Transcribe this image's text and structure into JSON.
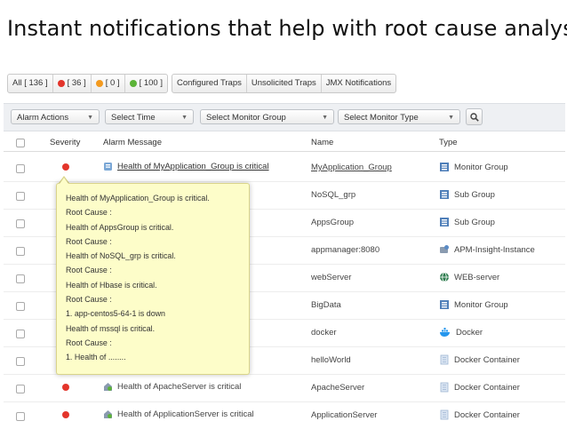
{
  "headline": "Instant notifications that help with root cause analysis",
  "filter_tabs": {
    "all": "All [ 136 ]",
    "critical": "[ 36 ]",
    "warning": "[ 0 ]",
    "clear": "[ 100 ]",
    "configured_traps": "Configured Traps",
    "unsolicited_traps": "Unsolicited Traps",
    "jmx": "JMX Notifications"
  },
  "toolbar": {
    "alarm_actions": "Alarm Actions",
    "select_time": "Select Time",
    "select_monitor_group": "Select Monitor Group",
    "select_monitor_type": "Select Monitor Type"
  },
  "columns": {
    "severity": "Severity",
    "message": "Alarm Message",
    "name": "Name",
    "type": "Type"
  },
  "rows": [
    {
      "message": "Health of MyApplication_Group is critical",
      "name": "MyApplication_Group",
      "type": "Monitor Group"
    },
    {
      "message": "",
      "name": "NoSQL_grp",
      "type": "Sub Group"
    },
    {
      "message": "",
      "name": "AppsGroup",
      "type": "Sub Group"
    },
    {
      "message": "",
      "name": "appmanager:8080",
      "type": "APM-Insight-Instance"
    },
    {
      "message": "",
      "name": "webServer",
      "type": "WEB-server"
    },
    {
      "message": "",
      "name": "BigData",
      "type": "Monitor Group"
    },
    {
      "message": "",
      "name": "docker",
      "type": "Docker"
    },
    {
      "message": "",
      "name": "helloWorld",
      "type": "Docker Container"
    },
    {
      "message": "Health of ApacheServer is critical",
      "name": "ApacheServer",
      "type": "Docker Container"
    },
    {
      "message": "Health of ApplicationServer is critical",
      "name": "ApplicationServer",
      "type": "Docker Container"
    }
  ],
  "tooltip": [
    "Health of MyApplication_Group is critical.",
    "Root Cause :",
    "Health of AppsGroup is critical.",
    "Root Cause :",
    "Health of NoSQL_grp is critical.",
    "Root Cause :",
    "Health of Hbase is critical.",
    "Root Cause :",
    "1. app-centos5-64-1 is down",
    "Health of mssql is critical.",
    "Root Cause :",
    "1. Health of ........"
  ],
  "colors": {
    "critical": "#e3352b",
    "warning": "#f39a1f",
    "clear": "#5cb338",
    "tooltip_bg": "#fdfdc9"
  }
}
